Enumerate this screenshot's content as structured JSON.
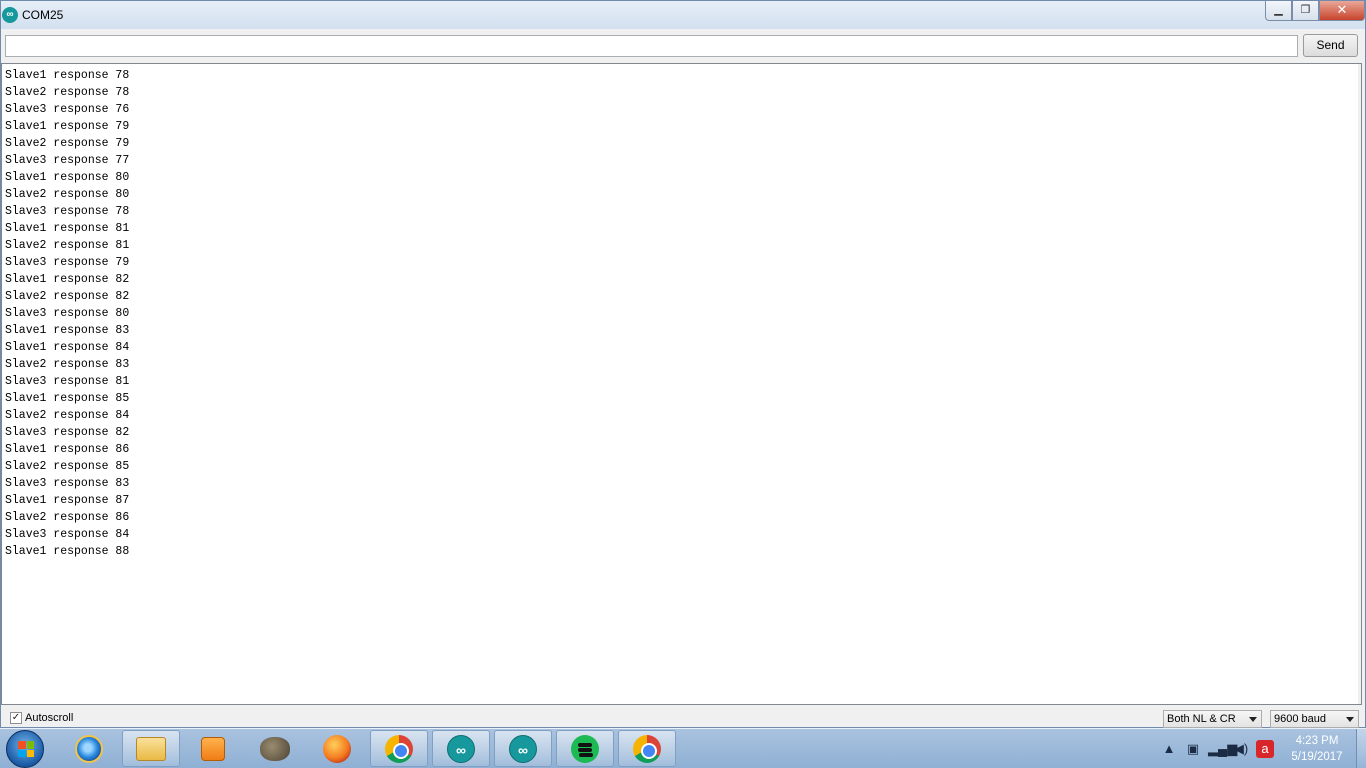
{
  "window": {
    "title": "COM25",
    "app_icon_glyph": "∞"
  },
  "toolbar": {
    "input_value": "",
    "send_label": "Send"
  },
  "output": {
    "lines": [
      "Slave1 response 78",
      "Slave2 response 78",
      "Slave3 response 76",
      "Slave1 response 79",
      "Slave2 response 79",
      "Slave3 response 77",
      "Slave1 response 80",
      "Slave2 response 80",
      "Slave3 response 78",
      "Slave1 response 81",
      "Slave2 response 81",
      "Slave3 response 79",
      "Slave1 response 82",
      "Slave2 response 82",
      "Slave3 response 80",
      "Slave1 response 83",
      "Slave1 response 84",
      "Slave2 response 83",
      "Slave3 response 81",
      "Slave1 response 85",
      "Slave2 response 84",
      "Slave3 response 82",
      "Slave1 response 86",
      "Slave2 response 85",
      "Slave3 response 83",
      "Slave1 response 87",
      "Slave2 response 86",
      "Slave3 response 84",
      "Slave1 response 88"
    ]
  },
  "footer": {
    "autoscroll_label": "Autoscroll",
    "autoscroll_checked": true,
    "line_ending": "Both NL & CR",
    "baud_rate": "9600 baud"
  },
  "taskbar": {
    "apps": [
      {
        "name": "internet-explorer-icon"
      },
      {
        "name": "file-explorer-icon"
      },
      {
        "name": "media-player-icon"
      },
      {
        "name": "gimp-icon"
      },
      {
        "name": "firefox-icon"
      },
      {
        "name": "chrome-icon"
      },
      {
        "name": "arduino-icon"
      },
      {
        "name": "arduino-icon"
      },
      {
        "name": "spotify-icon"
      },
      {
        "name": "chrome-icon"
      }
    ],
    "time": "4:23 PM",
    "date": "5/19/2017"
  },
  "colors": {
    "arduino_teal": "#17989c",
    "close_red": "#c8442c",
    "taskbar_blue": "#8fb0d4"
  }
}
